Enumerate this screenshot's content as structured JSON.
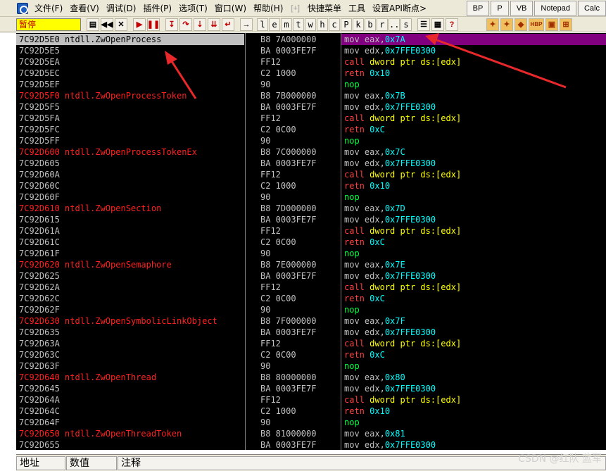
{
  "menu": {
    "items": [
      "文件(F)",
      "查看(V)",
      "调试(D)",
      "插件(P)",
      "选项(T)",
      "窗口(W)",
      "帮助(H)"
    ],
    "sep": "[+]",
    "extra": [
      "快捷菜单",
      "工具",
      "设置API断点>"
    ],
    "right_buttons": [
      "BP",
      "P",
      "VB",
      "Notepad",
      "Calc"
    ]
  },
  "toolbar": {
    "status": "暂停",
    "letters": [
      "l",
      "e",
      "m",
      "t",
      "w",
      "h",
      "c",
      "P",
      "k",
      "b",
      "r",
      "...",
      "s"
    ],
    "hbp": "HBP"
  },
  "rows": [
    {
      "addr": "7C92D5E0",
      "label": "ntdll.ZwOpenProcess",
      "hex": "B8 7A000000",
      "mn": "mov",
      "ops": [
        {
          "t": "reg",
          "v": "eax,"
        },
        {
          "t": "num",
          "v": "0x7A"
        }
      ],
      "sel": true
    },
    {
      "addr": "7C92D5E5",
      "label": "",
      "hex": "BA 0003FE7F",
      "mn": "mov",
      "ops": [
        {
          "t": "reg",
          "v": "edx,"
        },
        {
          "t": "num",
          "v": "0x7FFE0300"
        }
      ]
    },
    {
      "addr": "7C92D5EA",
      "label": "",
      "hex": "FF12",
      "mn": "call",
      "ops": [
        {
          "t": "mem",
          "v": "dword ptr ds:[edx]"
        }
      ]
    },
    {
      "addr": "7C92D5EC",
      "label": "",
      "hex": "C2 1000",
      "mn": "retn",
      "ops": [
        {
          "t": "num",
          "v": "0x10"
        }
      ]
    },
    {
      "addr": "7C92D5EF",
      "label": "",
      "hex": "90",
      "mn": "nop",
      "ops": []
    },
    {
      "addr": "7C92D5F0",
      "label": "ntdll.ZwOpenProcessToken",
      "hex": "B8 7B000000",
      "mn": "mov",
      "ops": [
        {
          "t": "reg",
          "v": "eax,"
        },
        {
          "t": "num",
          "v": "0x7B"
        }
      ]
    },
    {
      "addr": "7C92D5F5",
      "label": "",
      "hex": "BA 0003FE7F",
      "mn": "mov",
      "ops": [
        {
          "t": "reg",
          "v": "edx,"
        },
        {
          "t": "num",
          "v": "0x7FFE0300"
        }
      ]
    },
    {
      "addr": "7C92D5FA",
      "label": "",
      "hex": "FF12",
      "mn": "call",
      "ops": [
        {
          "t": "mem",
          "v": "dword ptr ds:[edx]"
        }
      ]
    },
    {
      "addr": "7C92D5FC",
      "label": "",
      "hex": "C2 0C00",
      "mn": "retn",
      "ops": [
        {
          "t": "num",
          "v": "0xC"
        }
      ]
    },
    {
      "addr": "7C92D5FF",
      "label": "",
      "hex": "90",
      "mn": "nop",
      "ops": []
    },
    {
      "addr": "7C92D600",
      "label": "ntdll.ZwOpenProcessTokenEx",
      "hex": "B8 7C000000",
      "mn": "mov",
      "ops": [
        {
          "t": "reg",
          "v": "eax,"
        },
        {
          "t": "num",
          "v": "0x7C"
        }
      ]
    },
    {
      "addr": "7C92D605",
      "label": "",
      "hex": "BA 0003FE7F",
      "mn": "mov",
      "ops": [
        {
          "t": "reg",
          "v": "edx,"
        },
        {
          "t": "num",
          "v": "0x7FFE0300"
        }
      ]
    },
    {
      "addr": "7C92D60A",
      "label": "",
      "hex": "FF12",
      "mn": "call",
      "ops": [
        {
          "t": "mem",
          "v": "dword ptr ds:[edx]"
        }
      ]
    },
    {
      "addr": "7C92D60C",
      "label": "",
      "hex": "C2 1000",
      "mn": "retn",
      "ops": [
        {
          "t": "num",
          "v": "0x10"
        }
      ]
    },
    {
      "addr": "7C92D60F",
      "label": "",
      "hex": "90",
      "mn": "nop",
      "ops": []
    },
    {
      "addr": "7C92D610",
      "label": "ntdll.ZwOpenSection",
      "hex": "B8 7D000000",
      "mn": "mov",
      "ops": [
        {
          "t": "reg",
          "v": "eax,"
        },
        {
          "t": "num",
          "v": "0x7D"
        }
      ]
    },
    {
      "addr": "7C92D615",
      "label": "",
      "hex": "BA 0003FE7F",
      "mn": "mov",
      "ops": [
        {
          "t": "reg",
          "v": "edx,"
        },
        {
          "t": "num",
          "v": "0x7FFE0300"
        }
      ]
    },
    {
      "addr": "7C92D61A",
      "label": "",
      "hex": "FF12",
      "mn": "call",
      "ops": [
        {
          "t": "mem",
          "v": "dword ptr ds:[edx]"
        }
      ]
    },
    {
      "addr": "7C92D61C",
      "label": "",
      "hex": "C2 0C00",
      "mn": "retn",
      "ops": [
        {
          "t": "num",
          "v": "0xC"
        }
      ]
    },
    {
      "addr": "7C92D61F",
      "label": "",
      "hex": "90",
      "mn": "nop",
      "ops": []
    },
    {
      "addr": "7C92D620",
      "label": "ntdll.ZwOpenSemaphore",
      "hex": "B8 7E000000",
      "mn": "mov",
      "ops": [
        {
          "t": "reg",
          "v": "eax,"
        },
        {
          "t": "num",
          "v": "0x7E"
        }
      ]
    },
    {
      "addr": "7C92D625",
      "label": "",
      "hex": "BA 0003FE7F",
      "mn": "mov",
      "ops": [
        {
          "t": "reg",
          "v": "edx,"
        },
        {
          "t": "num",
          "v": "0x7FFE0300"
        }
      ]
    },
    {
      "addr": "7C92D62A",
      "label": "",
      "hex": "FF12",
      "mn": "call",
      "ops": [
        {
          "t": "mem",
          "v": "dword ptr ds:[edx]"
        }
      ]
    },
    {
      "addr": "7C92D62C",
      "label": "",
      "hex": "C2 0C00",
      "mn": "retn",
      "ops": [
        {
          "t": "num",
          "v": "0xC"
        }
      ]
    },
    {
      "addr": "7C92D62F",
      "label": "",
      "hex": "90",
      "mn": "nop",
      "ops": []
    },
    {
      "addr": "7C92D630",
      "label": "ntdll.ZwOpenSymbolicLinkObject",
      "hex": "B8 7F000000",
      "mn": "mov",
      "ops": [
        {
          "t": "reg",
          "v": "eax,"
        },
        {
          "t": "num",
          "v": "0x7F"
        }
      ]
    },
    {
      "addr": "7C92D635",
      "label": "",
      "hex": "BA 0003FE7F",
      "mn": "mov",
      "ops": [
        {
          "t": "reg",
          "v": "edx,"
        },
        {
          "t": "num",
          "v": "0x7FFE0300"
        }
      ]
    },
    {
      "addr": "7C92D63A",
      "label": "",
      "hex": "FF12",
      "mn": "call",
      "ops": [
        {
          "t": "mem",
          "v": "dword ptr ds:[edx]"
        }
      ]
    },
    {
      "addr": "7C92D63C",
      "label": "",
      "hex": "C2 0C00",
      "mn": "retn",
      "ops": [
        {
          "t": "num",
          "v": "0xC"
        }
      ]
    },
    {
      "addr": "7C92D63F",
      "label": "",
      "hex": "90",
      "mn": "nop",
      "ops": []
    },
    {
      "addr": "7C92D640",
      "label": "ntdll.ZwOpenThread",
      "hex": "B8 80000000",
      "mn": "mov",
      "ops": [
        {
          "t": "reg",
          "v": "eax,"
        },
        {
          "t": "num",
          "v": "0x80"
        }
      ]
    },
    {
      "addr": "7C92D645",
      "label": "",
      "hex": "BA 0003FE7F",
      "mn": "mov",
      "ops": [
        {
          "t": "reg",
          "v": "edx,"
        },
        {
          "t": "num",
          "v": "0x7FFE0300"
        }
      ]
    },
    {
      "addr": "7C92D64A",
      "label": "",
      "hex": "FF12",
      "mn": "call",
      "ops": [
        {
          "t": "mem",
          "v": "dword ptr ds:[edx]"
        }
      ]
    },
    {
      "addr": "7C92D64C",
      "label": "",
      "hex": "C2 1000",
      "mn": "retn",
      "ops": [
        {
          "t": "num",
          "v": "0x10"
        }
      ]
    },
    {
      "addr": "7C92D64F",
      "label": "",
      "hex": "90",
      "mn": "nop",
      "ops": []
    },
    {
      "addr": "7C92D650",
      "label": "ntdll.ZwOpenThreadToken",
      "hex": "B8 81000000",
      "mn": "mov",
      "ops": [
        {
          "t": "reg",
          "v": "eax,"
        },
        {
          "t": "num",
          "v": "0x81"
        }
      ]
    },
    {
      "addr": "7C92D655",
      "label": "",
      "hex": "BA 0003FE7F",
      "mn": "mov",
      "ops": [
        {
          "t": "reg",
          "v": "edx,"
        },
        {
          "t": "num",
          "v": "0x7FFE0300"
        }
      ]
    }
  ],
  "bottom": {
    "headers": [
      "地址",
      "数值",
      "注释"
    ]
  },
  "watermark": "CSDN @红队 蓝军",
  "colors": {
    "label_red": "#ff2020",
    "selection_purple": "#800080",
    "number_cyan": "#00ffff",
    "memory_yellow": "#ffff00",
    "nop_green": "#00ff40",
    "annotation_arrow": "#e8282a"
  }
}
